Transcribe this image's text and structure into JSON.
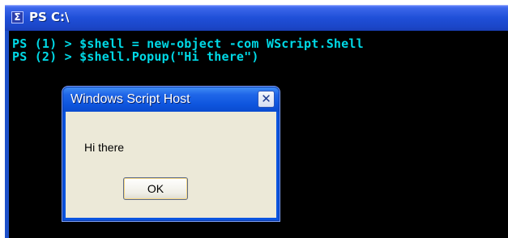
{
  "console": {
    "title": "PS C:\\",
    "icon": "powershell-icon",
    "lines": [
      "PS (1) > $shell = new-object -com WScript.Shell",
      "PS (2) > $shell.Popup(\"Hi there\")"
    ],
    "text_color": "#00d9e6",
    "background": "#000000"
  },
  "dialog": {
    "title": "Windows Script Host",
    "message": "Hi there",
    "ok_label": "OK",
    "close_icon": "close-icon",
    "titlebar_color": "#0a54e0",
    "body_color": "#ece9d8"
  }
}
